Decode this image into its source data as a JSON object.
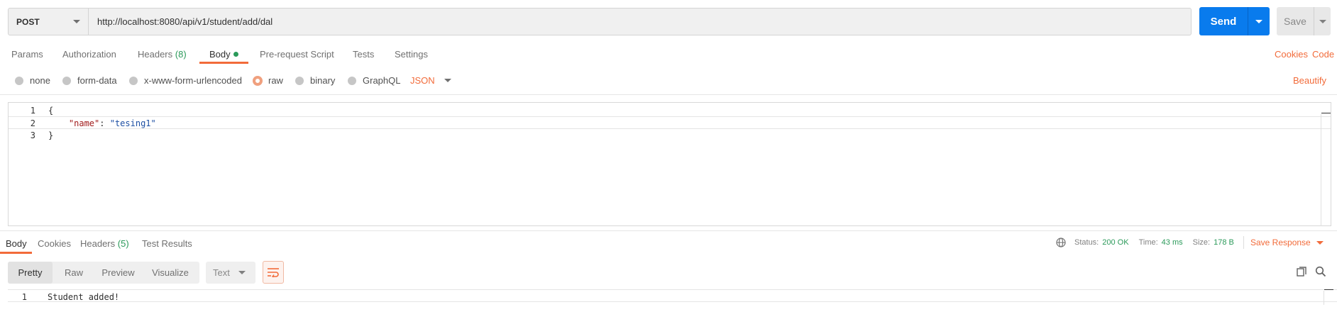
{
  "request": {
    "method": "POST",
    "url": "http://localhost:8080/api/v1/student/add/dal",
    "send_label": "Send",
    "save_label": "Save"
  },
  "request_tabs": {
    "params": "Params",
    "authorization": "Authorization",
    "headers": "Headers",
    "headers_count": "(8)",
    "body": "Body",
    "pre_request": "Pre-request Script",
    "tests": "Tests",
    "settings": "Settings",
    "cookies": "Cookies",
    "code": "Code"
  },
  "body_types": {
    "none": "none",
    "form_data": "form-data",
    "urlencoded": "x-www-form-urlencoded",
    "raw": "raw",
    "binary": "binary",
    "graphql": "GraphQL",
    "selected": "raw",
    "language": "JSON",
    "beautify": "Beautify"
  },
  "editor": {
    "lines": [
      {
        "number": "1",
        "text": "{"
      },
      {
        "number": "2",
        "key": "\"name\"",
        "sep": ": ",
        "value": "\"tesing1\""
      },
      {
        "number": "3",
        "text": "}"
      }
    ]
  },
  "response_tabs": {
    "body": "Body",
    "cookies": "Cookies",
    "headers": "Headers",
    "headers_count": "(5)",
    "test_results": "Test Results"
  },
  "response_status": {
    "status_label": "Status:",
    "status_value": "200 OK",
    "time_label": "Time:",
    "time_value": "43 ms",
    "size_label": "Size:",
    "size_value": "178 B",
    "save_response": "Save Response"
  },
  "view_modes": {
    "pretty": "Pretty",
    "raw": "Raw",
    "preview": "Preview",
    "visualize": "Visualize",
    "format": "Text"
  },
  "response_body": {
    "line_number": "1",
    "text": "Student added!"
  },
  "colors": {
    "accent": "#f26b3a",
    "send": "#097bed",
    "success": "#2b9a5a"
  },
  "icons": {
    "globe": "globe-icon",
    "wrap": "wrap-lines-icon",
    "copy": "copy-icon",
    "search": "search-icon"
  }
}
